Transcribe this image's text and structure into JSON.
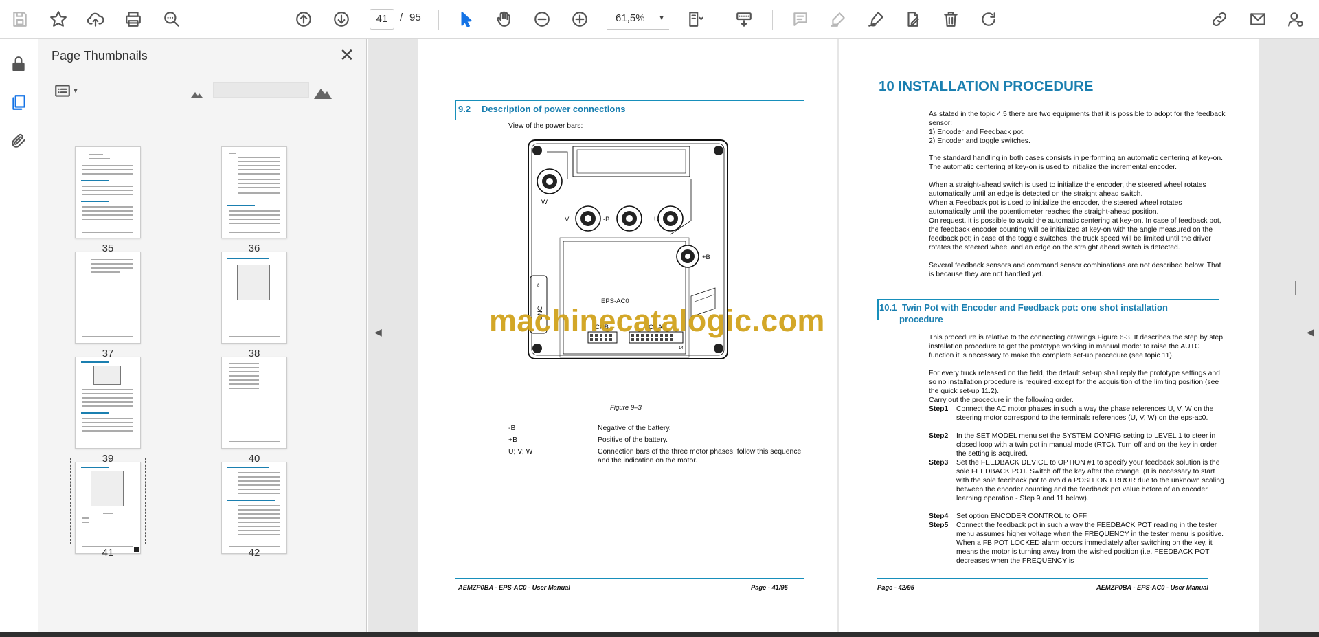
{
  "toolbar": {
    "page_current": "41",
    "page_sep": "/",
    "page_total": "95",
    "zoom": "61,5%"
  },
  "panel": {
    "title": "Page Thumbnails"
  },
  "thumbnails": [
    {
      "label": "35"
    },
    {
      "label": "36"
    },
    {
      "label": "37"
    },
    {
      "label": "38"
    },
    {
      "label": "39"
    },
    {
      "label": "40"
    },
    {
      "label": "41"
    },
    {
      "label": "42"
    }
  ],
  "page41": {
    "section_number": "9.2",
    "section_title": "Description of power connections",
    "intro": "View of the power bars:",
    "figure_caption": "Figure 9–3",
    "diagram": {
      "label_w": "W",
      "label_v": "V",
      "label_neg_b": "-B",
      "label_u": "U",
      "label_pos_b": "+B",
      "label_cnc": "CNC",
      "label_model": "EPS-AC0",
      "label_cnb": "CNB",
      "label_cna": "CNA",
      "label_pin14": "14",
      "label_pin8": "8"
    },
    "table": [
      {
        "term": "-B",
        "desc": "Negative of the battery."
      },
      {
        "term": "+B",
        "desc": "Positive of the battery."
      },
      {
        "term": "U; V; W",
        "desc": "Connection bars of the three motor phases; follow this sequence and the indication on the motor."
      }
    ],
    "footer_left": "AEMZP0BA - EPS-AC0 - User Manual",
    "footer_right": "Page - 41/95"
  },
  "page42": {
    "chapter_title": "10 INSTALLATION PROCEDURE",
    "p1": "As stated in the topic 4.5 there are two equipments that it is possible to adopt for the feedback sensor:",
    "list1": "1)    Encoder and Feedback pot.",
    "list2": "2)    Encoder and toggle switches.",
    "p2": "The standard handling in both cases consists in performing an automatic centering at key-on. The automatic centering at key-on is used to initialize the incremental encoder.",
    "p3": "When a straight-ahead switch is used to initialize the encoder, the steered wheel rotates automatically until an edge is detected on the straight ahead switch.",
    "p4": "When a Feedback pot is used to initialize the encoder, the steered wheel rotates automatically until the potentiometer reaches the straight-ahead position.",
    "p5": "On request, it is possible to avoid the automatic centering at key-on. In case of feedback pot, the feedback encoder counting will be initialized at key-on with the angle measured on the feedback pot; in case of the toggle switches, the truck speed will be limited until the driver rotates the steered wheel and an edge on the straight ahead switch is detected.",
    "p6": "Several feedback sensors and command sensor combinations are not described below. That is because they are not handled yet.",
    "sub_number": "10.1",
    "sub_title_1": "Twin Pot with Encoder and Feedback pot: one shot installation",
    "sub_title_2": "procedure",
    "p7": "This procedure is relative to the connecting drawings Figure 6-3. It describes the step by step installation procedure to get the prototype working in manual mode: to raise the AUTC function it is necessary to make the complete set-up procedure (see topic 11).",
    "p8": "For every truck released on the field, the default set-up shall reply the prototype settings and so no installation procedure is required except for the acquisition of the limiting position (see the quick set-up 11.2).",
    "p9": "Carry out the procedure in the following order.",
    "steps": [
      {
        "label": "Step1",
        "text": "Connect the AC motor phases in such a way the phase references U, V, W on the steering motor correspond to the terminals references (U, V, W) on the eps-ac0."
      },
      {
        "label": "Step2",
        "text": "In the SET MODEL menu set the SYSTEM CONFIG setting to LEVEL 1 to steer in closed loop with a twin pot in manual mode (RTC). Turn off and on the key in order the setting is acquired."
      },
      {
        "label": "Step3",
        "text": "Set the FEEDBACK DEVICE to OPTION #1 to specify your feedback solution is the sole FEEDBACK POT. Switch off the key after the change. (It is necessary to start with the sole feedback pot to avoid a POSITION ERROR due to the unknown scaling between the encoder counting and the feedback pot value before of an encoder learning operation - Step 9 and 11 below)."
      },
      {
        "label": "Step4",
        "text": "Set option ENCODER CONTROL to OFF."
      },
      {
        "label": "Step5",
        "text": "Connect the feedback pot in such a way the FEEDBACK POT reading in the tester menu assumes higher voltage when the FREQUENCY in the tester menu is positive. When a FB POT LOCKED alarm occurs immediately after switching on the key, it means the motor is turning away from the wished position (i.e. FEEDBACK POT decreases when the FREQUENCY is"
      }
    ],
    "footer_left": "Page - 42/95",
    "footer_right": "AEMZP0BA - EPS-AC0 - User Manual"
  },
  "watermark": "machinecatalogic.com",
  "colors": {
    "accent_blue": "#1a7fb0",
    "watermark_gold": "#d1a31d",
    "tool_active": "#1473e6"
  }
}
